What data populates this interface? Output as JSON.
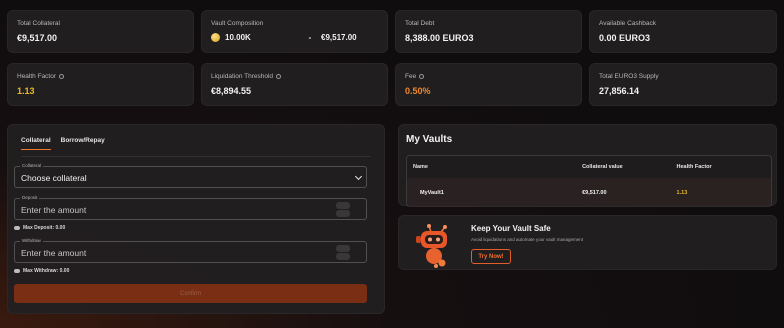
{
  "stats": [
    {
      "label": "Total Collateral",
      "value": "€9,517.00"
    },
    {
      "label": "Vault Composition",
      "coin_amount": "10.00K",
      "separator": "-",
      "fiat_amount": "€9,517.00"
    },
    {
      "label": "Total Debt",
      "value": "8,388.00 EURO3"
    },
    {
      "label": "Available Cashback",
      "value": "0.00 EURO3"
    },
    {
      "label": "Health Factor",
      "value": "1.13"
    },
    {
      "label": "Liquidation Threshold",
      "value": "€8,894.55"
    },
    {
      "label": "Fee",
      "value": "0.50%"
    },
    {
      "label": "Total EURO3 Supply",
      "value": "27,856.14"
    }
  ],
  "form": {
    "tabs": [
      "Collateral",
      "Borrow/Repay"
    ],
    "collateral_label": "Collateral",
    "collateral_value": "Choose collateral",
    "deposit_label": "Deposit",
    "deposit_placeholder": "Enter the amount",
    "max_deposit": "Max Deposit: 0.00",
    "withdraw_label": "Withdraw",
    "withdraw_placeholder": "Enter the amount",
    "max_withdraw": "Max Withdraw: 0.00",
    "submit_label": "Confirm"
  },
  "vaults": {
    "title": "My Vaults",
    "columns": [
      "Name",
      "Collateral value",
      "Health Factor"
    ],
    "rows": [
      {
        "name": "MyVault1",
        "collateral": "€9,517.00",
        "health": "1.13"
      }
    ]
  },
  "promo": {
    "title": "Keep Your Vault Safe",
    "subtitle": "Avoid liquidations and automate your vault management",
    "button": "Try Now!"
  },
  "colors": {
    "accent": "#f0772a",
    "health": "#e9b92b",
    "fee": "#f0882e"
  }
}
